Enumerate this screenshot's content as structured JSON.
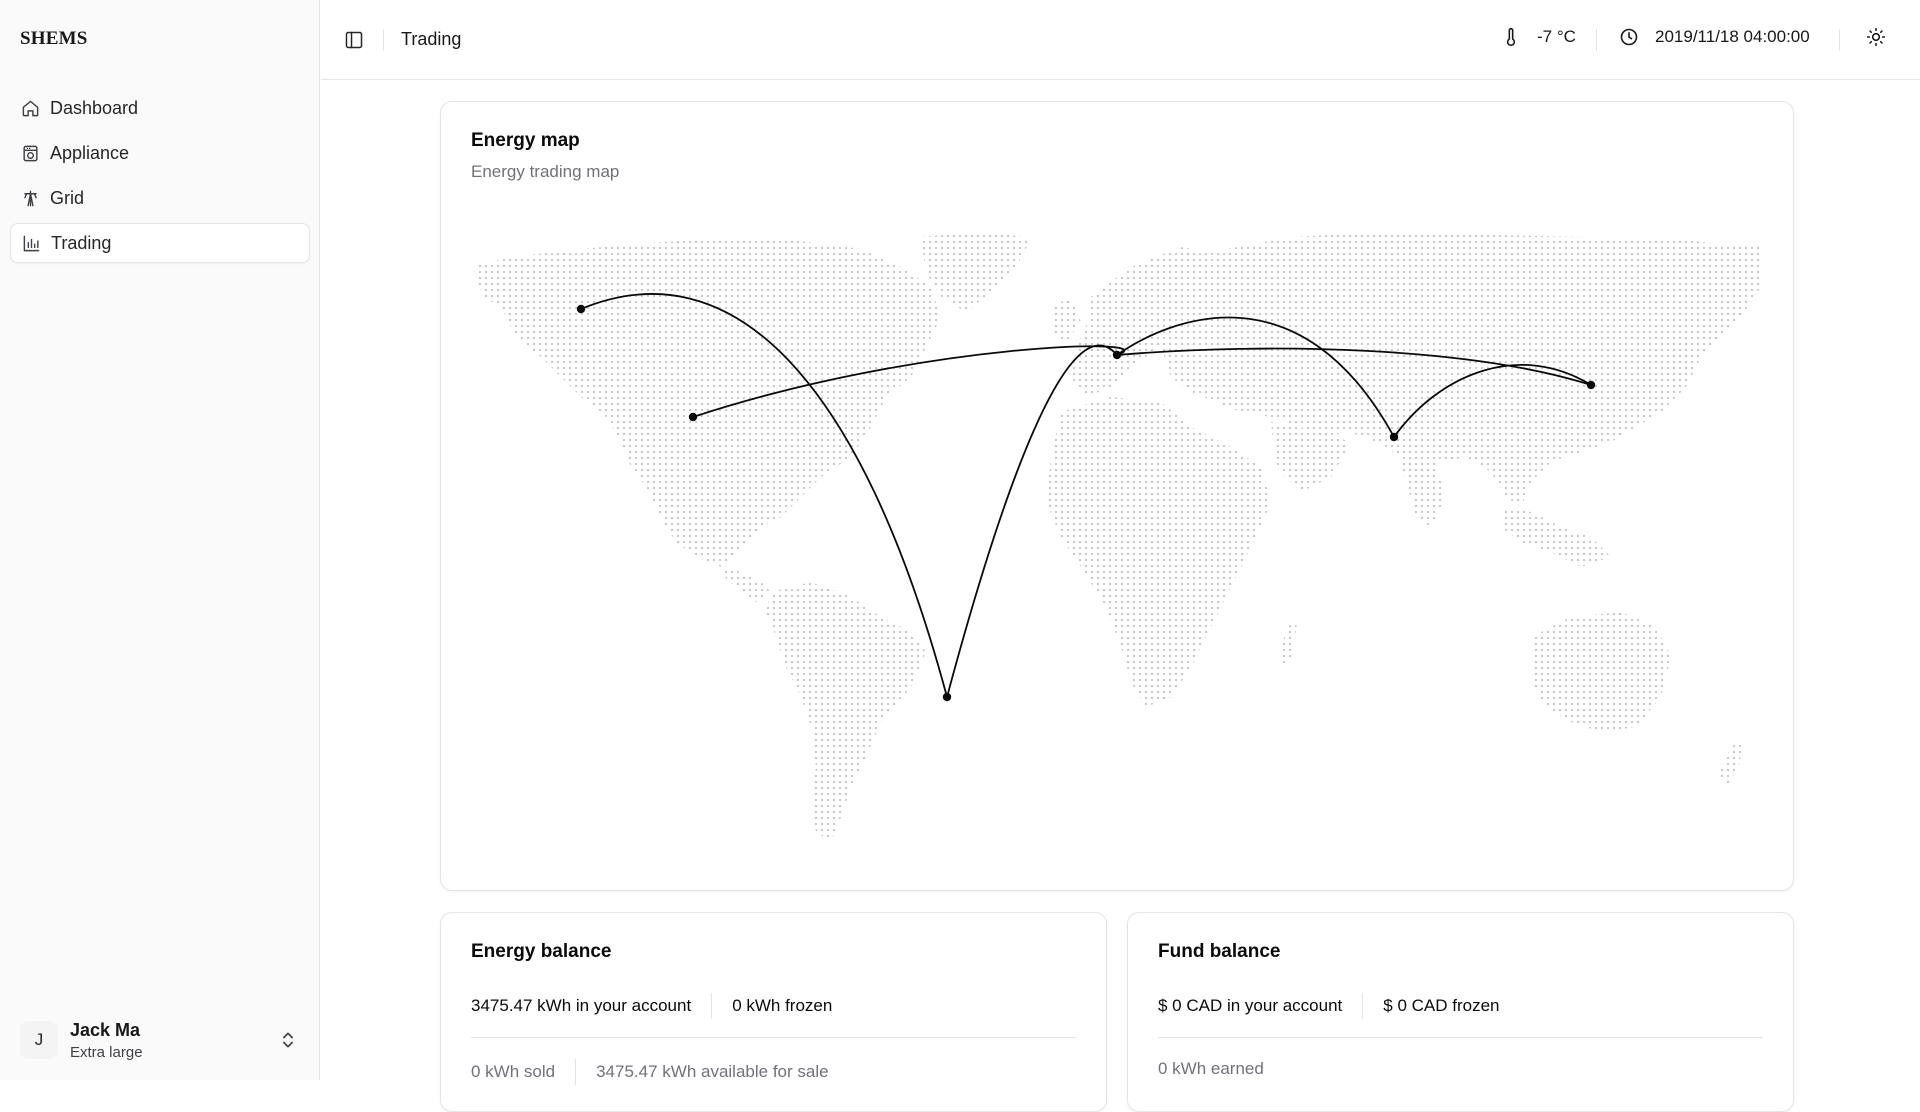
{
  "app": {
    "brand": "SHEMS"
  },
  "sidebar": {
    "items": [
      {
        "label": "Dashboard",
        "icon": "home-icon",
        "active": false
      },
      {
        "label": "Appliance",
        "icon": "appliance-icon",
        "active": false
      },
      {
        "label": "Grid",
        "icon": "grid-tower-icon",
        "active": false
      },
      {
        "label": "Trading",
        "icon": "chart-bar-icon",
        "active": true
      }
    ],
    "user": {
      "initial": "J",
      "name": "Jack Ma",
      "plan": "Extra large"
    }
  },
  "header": {
    "breadcrumb": "Trading",
    "temperature": "-7 °C",
    "datetime": "2019/11/18 04:00:00"
  },
  "energy_map": {
    "title": "Energy map",
    "subtitle": "Energy trading map"
  },
  "energy_balance": {
    "title": "Energy balance",
    "in_account": "3475.47 kWh in your account",
    "frozen": "0 kWh frozen",
    "sold": "0 kWh sold",
    "available": "3475.47 kWh available for sale"
  },
  "fund_balance": {
    "title": "Fund balance",
    "in_account": "$ 0 CAD in your account",
    "frozen": "$ 0 CAD frozen",
    "earned": "0 kWh earned"
  },
  "colors": {
    "accent": "#0a0a0a",
    "muted": "#71717a",
    "border": "#e4e4e7",
    "map_dots": "#c4c4c4"
  }
}
